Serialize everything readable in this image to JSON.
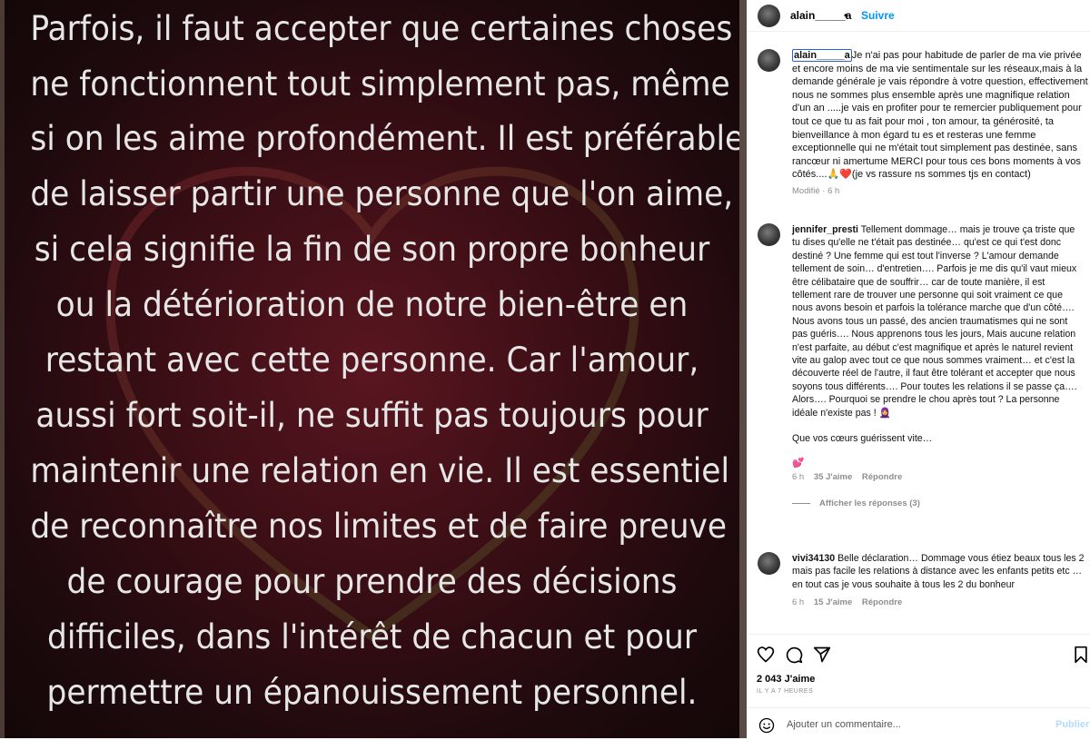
{
  "post_image": {
    "quote_lines": [
      "Parfois, il faut accepter que certaines choses",
      "ne fonctionnent tout simplement pas, même",
      "si on les aime profondément. Il est préférable",
      "de laisser partir une personne que l'on aime,",
      "si cela signifie la fin de son propre bonheur",
      "ou la détérioration de notre bien-être en",
      "restant avec cette personne. Car l'amour,",
      "aussi fort soit-il, ne suffit pas toujours pour",
      "maintenir une relation en vie. Il est essentiel",
      "de reconnaître nos limites et de faire preuve",
      "de courage pour prendre des décisions",
      "difficiles, dans l'intérêt de chacun et pour",
      "permettre un épanouissement personnel."
    ]
  },
  "header": {
    "username": "alain_____a",
    "separator": "•",
    "follow_label": "Suivre"
  },
  "caption": {
    "username": "alain_____a",
    "text": "Je n'ai pas pour habitude de parler de ma vie privée et encore moins de ma vie sentimentale sur les réseaux,mais à la demande générale je vais répondre à votre question, effectivement nous ne sommes plus ensemble après une magnifique relation d'un an .....je vais en profiter pour te remercier publiquement pour tout ce que tu as fait pour moi , ton amour, ta générosité, ta bienveillance à mon égard tu es et resteras une femme exceptionnelle qui ne m'était tout simplement pas destinée, sans rancœur ni amertume MERCI pour tous ces bons moments à vos côtés....🙏❤️(je vs rassure ns sommes tjs en contact)",
    "meta": "Modifié · 6 h"
  },
  "comments": [
    {
      "username": "jennifer_presti",
      "text": "Tellement dommage… mais je trouve ça triste que tu dises qu'elle ne t'était pas destinée… qu'est ce qui t'est donc destiné ? Une femme qui est tout l'inverse ? L'amour demande tellement de soin… d'entretien…. Parfois je me dis qu'il vaut mieux être célibataire que de souffrir… car de toute manière, il est tellement rare de trouver une personne qui soit vraiment ce que nous avons besoin et parfois la tolérance marche que d'un côté…. Nous avons tous un passé, des ancien traumatismes qui ne sont pas guéris…. Nous apprenons tous les jours, Mais aucune relation n'est parfaite, au début c'est magnifique et après le naturel revient vite au galop avec tout ce que nous sommes vraiment… et c'est la découverte réel de l'autre, il faut être tolérant et accepter que nous soyons tous différents…. Pour toutes les relations il se passe ça…. Alors…. Pourquoi se prendre le chou après tout ? La personne idéale n'existe pas ! 🧕",
      "extra": "Que vos cœurs guérissent vite…",
      "emoji": "💕",
      "time": "6 h",
      "likes": "35 J'aime",
      "reply": "Répondre",
      "replies": "Afficher les réponses (3)"
    },
    {
      "username": "vivi34130",
      "text": "Belle déclaration… Dommage vous étiez beaux tous les 2 mais pas facile les relations à distance avec les enfants petits etc … en tout cas je vous souhaite à tous les 2 du bonheur",
      "time": "6 h",
      "likes": "15 J'aime",
      "reply": "Répondre"
    }
  ],
  "actions": {
    "likes": "2 043 J'aime",
    "ago": "IL Y A 7 HEURES",
    "icons": [
      "heart-icon",
      "comment-icon",
      "share-icon",
      "bookmark-icon"
    ]
  },
  "add_comment": {
    "placeholder": "Ajouter un commentaire...",
    "publish_label": "Publier"
  },
  "colors": {
    "accent": "#0095f6",
    "publish_disabled": "#b3dbff",
    "muted": "#8e8e8e",
    "image_bg": "#3b0e15"
  }
}
